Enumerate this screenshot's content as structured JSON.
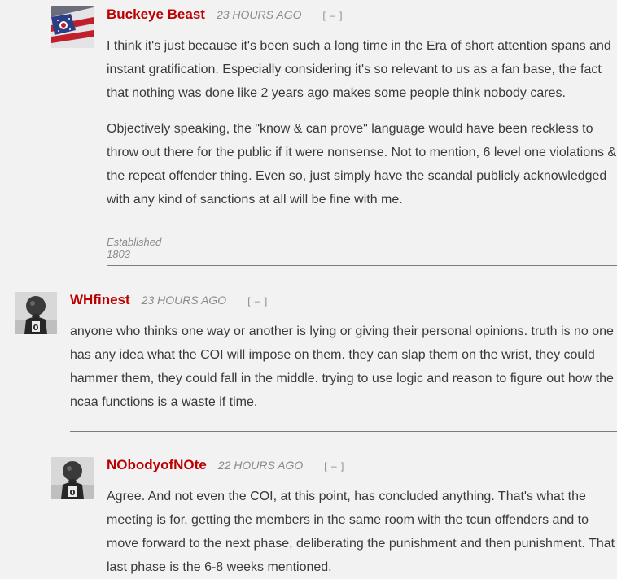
{
  "comments": [
    {
      "author": "Buckeye Beast",
      "time": "23 HOURS AGO",
      "collapse": "[ – ]",
      "paragraphs": [
        "I think it's just because it's been such a long time in the Era of short attention spans and instant gratification. Especially considering it's so relevant to us as a fan base, the fact that nothing was done like 2 years ago makes some people think nobody cares.",
        "Objectively speaking, the \"know & can prove\" language would have been reckless to throw out there for the public if it were nonsense. Not to mention, 6 level one violations & the repeat offender thing. Even so, just simply have the scandal publicly acknowledged with any kind of sanctions at all will be fine with me."
      ],
      "signature": "Established 1803",
      "avatar_icon": "ohio-flag-icon"
    },
    {
      "author": "WHfinest",
      "time": "23 HOURS AGO",
      "collapse": "[ – ]",
      "paragraphs": [
        "anyone who thinks one way or another is lying or giving their personal opinions.  truth is no one has any idea what the COI will impose on them.  they can slap them on the wrist, they could hammer them, they could fall in the middle.  trying to use logic and reason to figure out how the ncaa functions is a waste if time."
      ],
      "avatar_icon": "brutus-mascot-icon"
    },
    {
      "author": "NObodyofNOte",
      "time": "22 HOURS AGO",
      "collapse": "[ – ]",
      "paragraphs": [
        "Agree. And not even the COI, at this point, has concluded anything. That's what the meeting is for, getting the members in the same room with the tcun offenders and to move forward to the next phase, deliberating the punishment and then punishment. That last phase is the 6-8 weeks mentioned."
      ],
      "avatar_icon": "brutus-mascot-icon"
    }
  ],
  "colors": {
    "author": "#bb0000",
    "background": "#f2f2f2",
    "meta": "#8a8a8a"
  }
}
